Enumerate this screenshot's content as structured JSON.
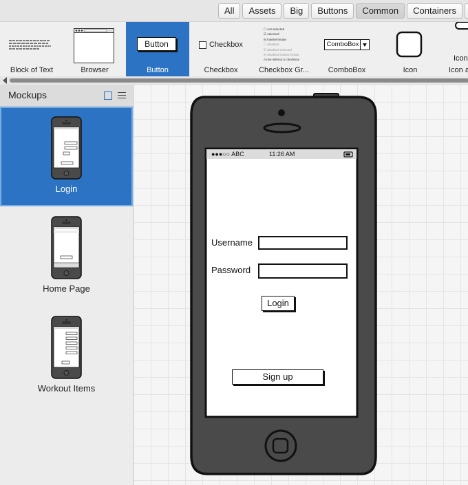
{
  "tabs": [
    {
      "label": "All",
      "active": false
    },
    {
      "label": "Assets",
      "active": false
    },
    {
      "label": "Big",
      "active": false
    },
    {
      "label": "Buttons",
      "active": false
    },
    {
      "label": "Common",
      "active": true
    },
    {
      "label": "Containers",
      "active": false
    }
  ],
  "gallery": {
    "items": [
      {
        "label": "Block of Text"
      },
      {
        "label": "Browser"
      },
      {
        "label": "Button",
        "preview": "Button",
        "selected": true
      },
      {
        "label": "Checkbox",
        "preview": "Checkbox"
      },
      {
        "label": "Checkbox Gr...",
        "preview_lines": [
          "not selected",
          "selected",
          "indeterminate",
          "disabled",
          "disabled selected",
          "disabled indeterminate",
          "A row without a checkbox"
        ]
      },
      {
        "label": "ComboBox",
        "preview": "ComboBox"
      },
      {
        "label": "Icon"
      },
      {
        "label": "Icon a",
        "preview": "Icon"
      }
    ]
  },
  "sidebar": {
    "title": "Mockups",
    "items": [
      {
        "label": "Login",
        "selected": true
      },
      {
        "label": "Home Page",
        "selected": false
      },
      {
        "label": "Workout Items",
        "selected": false
      }
    ]
  },
  "phone": {
    "status": {
      "carrier": "●●●○○ ABC",
      "time": "11:26 AM"
    },
    "username_label": "Username",
    "password_label": "Password",
    "login_label": "Login",
    "signup_label": "Sign up"
  },
  "colors": {
    "accent": "#2d73c4",
    "canvas_bg": "#f5f5f5",
    "phone_body": "#4a4a4a"
  }
}
